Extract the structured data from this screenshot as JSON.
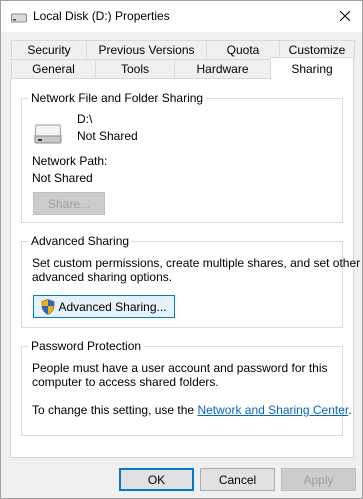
{
  "window": {
    "title": "Local Disk (D:) Properties",
    "icon": "drive-icon"
  },
  "tabs": {
    "row1": [
      "Security",
      "Previous Versions",
      "Quota",
      "Customize"
    ],
    "row2": [
      "General",
      "Tools",
      "Hardware",
      "Sharing"
    ],
    "selected": "Sharing"
  },
  "network_sharing": {
    "title": "Network File and Folder Sharing",
    "drive_name": "D:\\",
    "drive_status": "Not Shared",
    "path_label": "Network Path:",
    "path_value": "Not Shared",
    "share_button": "Share..."
  },
  "advanced_sharing": {
    "title": "Advanced Sharing",
    "description_line1": "Set custom permissions, create multiple shares, and set other",
    "description_line2": "advanced sharing options.",
    "button": "Advanced Sharing..."
  },
  "password_protection": {
    "title": "Password Protection",
    "line1": "People must have a user account and password for this",
    "line2": "computer to access shared folders.",
    "change_prefix": "To change this setting, use the ",
    "link": "Network and Sharing Center",
    "change_suffix": "."
  },
  "footer": {
    "ok": "OK",
    "cancel": "Cancel",
    "apply": "Apply"
  },
  "colors": {
    "accent": "#0078d7",
    "link": "#0066cc",
    "disabled_text": "#a0a0a0"
  }
}
